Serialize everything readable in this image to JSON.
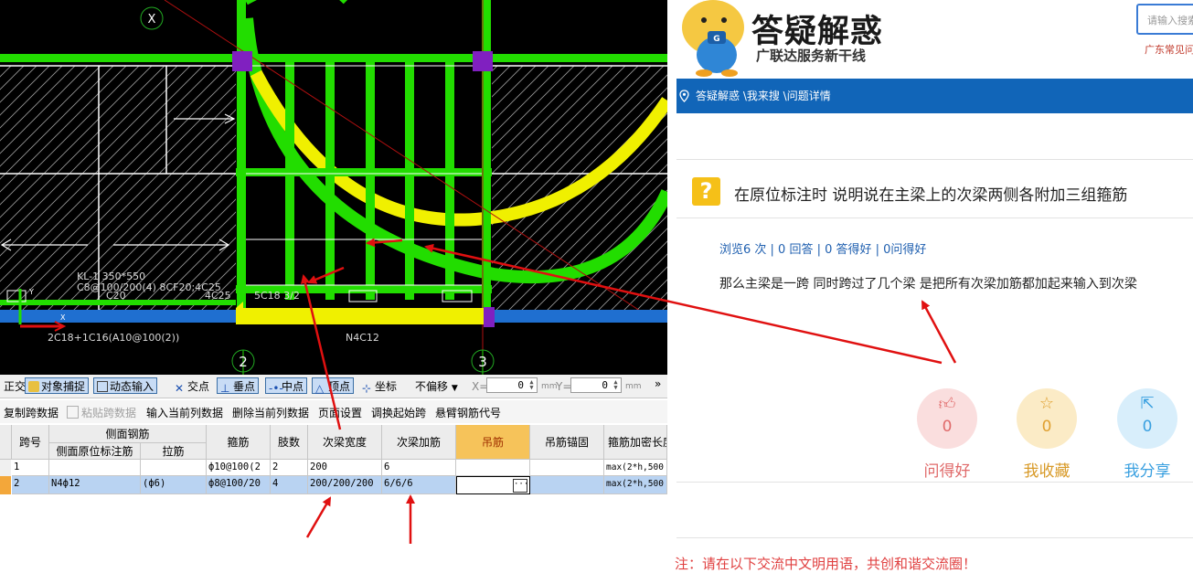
{
  "cad": {
    "axis_labels": {
      "top": "X",
      "bottom_left": "2",
      "bottom_right": "3"
    },
    "beam_text_1": "KL-1 350*550",
    "beam_text_2": "C8@100/200(4) 8CF20;4C25",
    "beam_text_3": "C20",
    "beam_text_4": "4C25",
    "beam_text_5": "5C18 3/2",
    "beam_text_6": "2C18+1C16(A10@100(2))",
    "beam_text_7": "N4C12"
  },
  "snapbar": {
    "items": [
      "正交",
      "对象捕捉",
      "动态输入",
      "交点",
      "垂点",
      "中点",
      "顶点",
      "坐标"
    ],
    "offset_select": "不偏移",
    "x_label": "X=",
    "x_value": "0",
    "y_label": "Y=",
    "y_value": "0",
    "unit": "mm",
    "more": "»"
  },
  "toolbar2": {
    "copy": "复制跨数据",
    "paste": "粘贴跨数据",
    "input_col": "输入当前列数据",
    "delete_col": "删除当前列数据",
    "page_setup": "页面设置",
    "swap_span": "调换起始跨",
    "cantilever": "悬臂钢筋代号"
  },
  "grid": {
    "headers": {
      "span": "跨号",
      "side_group": "侧面钢筋",
      "side_orig": "侧面原位标注筋",
      "tie": "拉筋",
      "stirrup": "箍筋",
      "legs": "肢数",
      "sec_width": "次梁宽度",
      "sec_add": "次梁加筋",
      "hanger": "吊筋",
      "hanger_anchor": "吊筋锚固",
      "stirrup_dense": "箍筋加密长度"
    },
    "rows": [
      {
        "span": "1",
        "side_orig": "",
        "tie": "",
        "stirrup": "ф10@100(2",
        "legs": "2",
        "sec_width": "200",
        "sec_add": "6",
        "hanger": "",
        "hanger_anchor": "",
        "stirrup_dense": "max(2*h,500"
      },
      {
        "span": "2",
        "side_orig": "N4ф12",
        "tie": "(ф6)",
        "stirrup": "ф8@100/20",
        "legs": "4",
        "sec_width": "200/200/200",
        "sec_add": "6/6/6",
        "hanger": "",
        "hanger_anchor": "",
        "stirrup_dense": "max(2*h,500"
      }
    ],
    "ellipsis": "···"
  },
  "qa": {
    "logo_title": "答疑解惑",
    "logo_sub": "广联达服务新干线",
    "search_placeholder": "请输入搜索",
    "search_note": "广东常见问",
    "breadcrumb": "答疑解惑 \\我来搜 \\问题详情",
    "question_title": "在原位标注时 说明说在主梁上的次梁两侧各附加三组箍筋",
    "stats": "浏览6 次 | 0 回答 | 0 答得好 | 0问得好",
    "body": "那么主梁是一跨 同时跨过了几个梁 是把所有次梁加筋都加起来输入到次梁",
    "actions": [
      {
        "label": "问得好",
        "count": "0",
        "icon": "thumbs-up-icon"
      },
      {
        "label": "我收藏",
        "count": "0",
        "icon": "star-icon"
      },
      {
        "label": "我分享",
        "count": "0",
        "icon": "share-icon"
      }
    ],
    "footer_note": "注：请在以下交流中文明用语，共创和谐交流圈！"
  },
  "colors": {
    "beam_green": "#22dd00",
    "beam_yellow": "#f0f000",
    "column_purple": "#8020c0",
    "annotation_red": "#e01010",
    "brand_blue": "#1165b8"
  }
}
